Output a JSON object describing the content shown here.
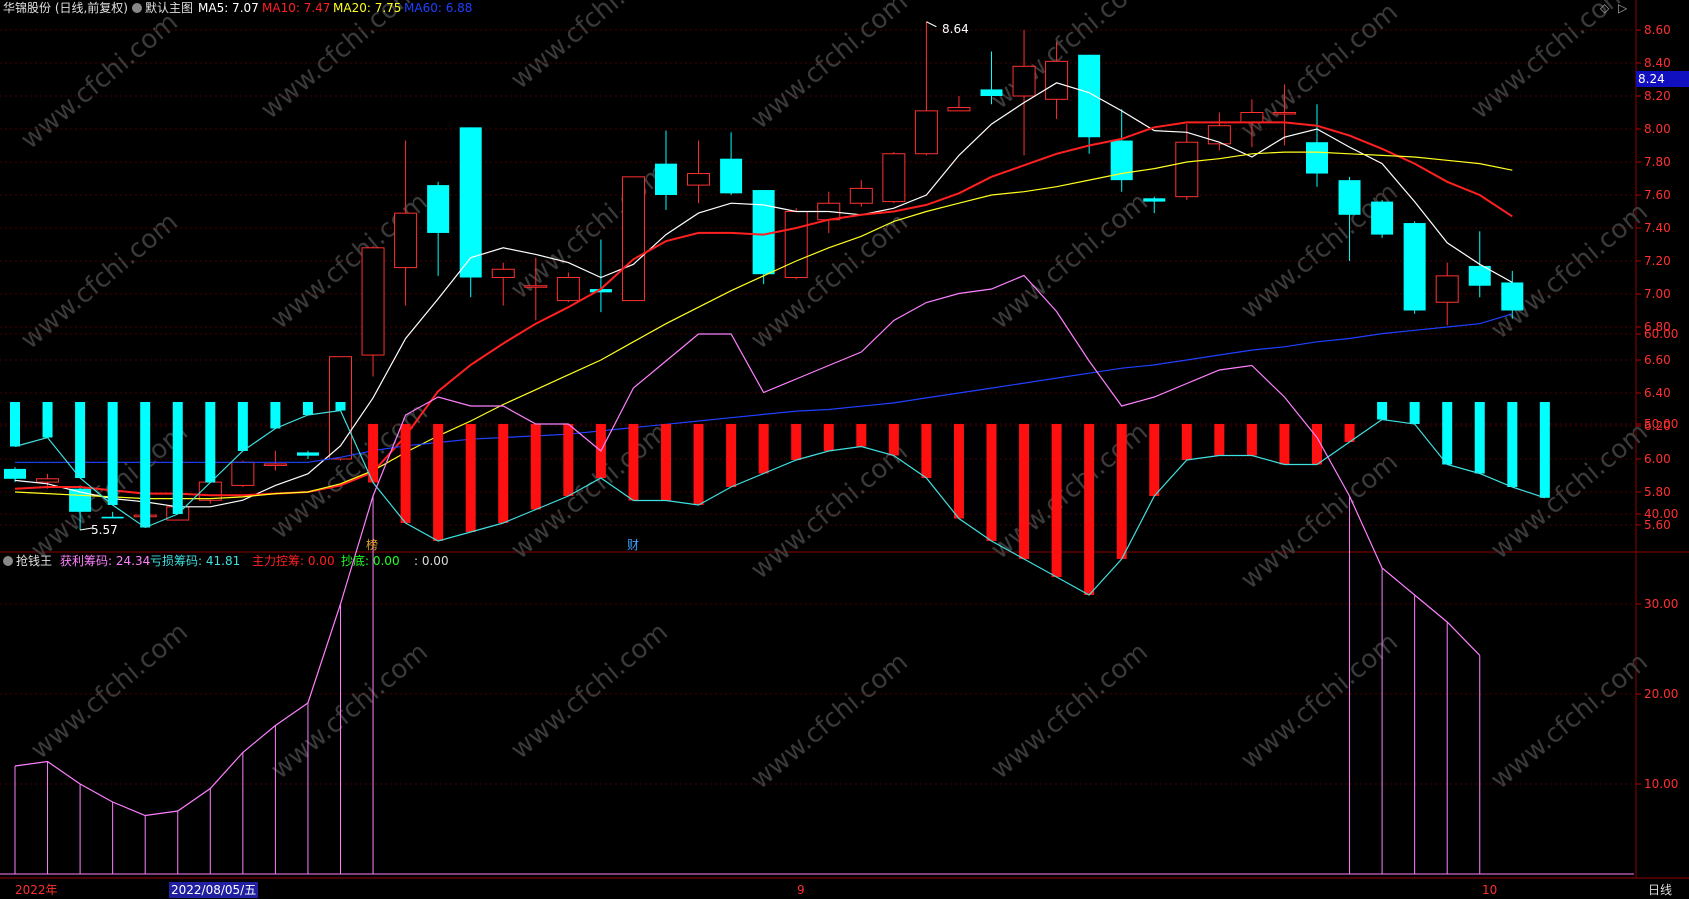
{
  "header": {
    "stock": "华锦股份 (日线,前复权)",
    "template": "默认主图",
    "ma": [
      {
        "label": "MA5: 7.07",
        "color": "#ffffff"
      },
      {
        "label": "MA10: 7.47",
        "color": "#ff2020"
      },
      {
        "label": "MA20: 7.75",
        "color": "#ffff20"
      },
      {
        "label": "MA60: 6.88",
        "color": "#2040ff"
      }
    ]
  },
  "indicator": {
    "name": "抢钱王",
    "items": [
      {
        "label": "获利筹码: 24.34",
        "color": "#ff80ff"
      },
      {
        "label": "亏损筹码: 41.81",
        "color": "#40e0e0"
      },
      {
        "label": "主力控筹: 0.00",
        "color": "#ff2020"
      },
      {
        "label": "抄底: 0.00",
        "color": "#20ff20"
      },
      {
        "label": ": 0.00",
        "color": "#dddddd"
      }
    ]
  },
  "markers": {
    "high": "8.64",
    "low": "5.57",
    "current": "8.24",
    "bang": "榜",
    "cai": "财"
  },
  "xaxis": {
    "year": "2022年",
    "date": "2022/08/05/五",
    "m9": "9",
    "m10": "10",
    "period": "日线"
  },
  "watermark": "www.cfchi.com",
  "chart_data": [
    {
      "type": "candlestick",
      "ylim": [
        5.45,
        8.72
      ],
      "yticks": [
        "8.60",
        "8.40",
        "8.20",
        "8.00",
        "7.80",
        "7.60",
        "7.40",
        "7.20",
        "7.00",
        "6.80",
        "6.60",
        "6.40",
        "6.20",
        "6.00",
        "5.80",
        "5.60"
      ],
      "candles": [
        {
          "o": 5.94,
          "c": 5.88,
          "h": 5.95,
          "l": 5.86
        },
        {
          "o": 5.86,
          "c": 5.88,
          "h": 5.91,
          "l": 5.82
        },
        {
          "o": 5.82,
          "c": 5.68,
          "h": 5.84,
          "l": 5.57
        },
        {
          "o": 5.65,
          "c": 5.64,
          "h": 5.68,
          "l": 5.64
        },
        {
          "o": 5.65,
          "c": 5.66,
          "h": 5.7,
          "l": 5.62
        },
        {
          "o": 5.63,
          "c": 5.71,
          "h": 5.74,
          "l": 5.63
        },
        {
          "o": 5.75,
          "c": 5.86,
          "h": 5.87,
          "l": 5.73
        },
        {
          "o": 5.84,
          "c": 5.98,
          "h": 5.99,
          "l": 5.83
        },
        {
          "o": 5.97,
          "c": 5.97,
          "h": 6.05,
          "l": 5.93
        },
        {
          "o": 6.04,
          "c": 6.02,
          "h": 6.05,
          "l": 6.0
        },
        {
          "o": 6.0,
          "c": 6.62,
          "h": 6.62,
          "l": 5.99
        },
        {
          "o": 6.63,
          "c": 7.28,
          "h": 7.29,
          "l": 6.5
        },
        {
          "o": 7.16,
          "c": 7.49,
          "h": 7.93,
          "l": 6.93
        },
        {
          "o": 7.66,
          "c": 7.37,
          "h": 7.68,
          "l": 7.11
        },
        {
          "o": 8.01,
          "c": 7.1,
          "h": 8.01,
          "l": 6.98
        },
        {
          "o": 7.1,
          "c": 7.15,
          "h": 7.19,
          "l": 6.93
        },
        {
          "o": 7.05,
          "c": 7.05,
          "h": 7.22,
          "l": 6.84
        },
        {
          "o": 6.96,
          "c": 7.1,
          "h": 7.13,
          "l": 6.95
        },
        {
          "o": 7.03,
          "c": 7.01,
          "h": 7.33,
          "l": 6.89
        },
        {
          "o": 6.96,
          "c": 7.71,
          "h": 7.71,
          "l": 6.96
        },
        {
          "o": 7.79,
          "c": 7.6,
          "h": 7.99,
          "l": 7.51
        },
        {
          "o": 7.66,
          "c": 7.73,
          "h": 7.93,
          "l": 7.55
        },
        {
          "o": 7.82,
          "c": 7.61,
          "h": 7.98,
          "l": 7.6
        },
        {
          "o": 7.63,
          "c": 7.12,
          "h": 7.63,
          "l": 7.06
        },
        {
          "o": 7.1,
          "c": 7.5,
          "h": 7.52,
          "l": 7.09
        },
        {
          "o": 7.45,
          "c": 7.55,
          "h": 7.62,
          "l": 7.37
        },
        {
          "o": 7.55,
          "c": 7.64,
          "h": 7.69,
          "l": 7.53
        },
        {
          "o": 7.56,
          "c": 7.85,
          "h": 7.86,
          "l": 7.55
        },
        {
          "o": 7.85,
          "c": 8.11,
          "h": 8.65,
          "l": 7.84
        },
        {
          "o": 8.11,
          "c": 8.13,
          "h": 8.2,
          "l": 8.11
        },
        {
          "o": 8.24,
          "c": 8.2,
          "h": 8.47,
          "l": 8.15
        },
        {
          "o": 8.2,
          "c": 8.38,
          "h": 8.6,
          "l": 7.84
        },
        {
          "o": 8.18,
          "c": 8.41,
          "h": 8.53,
          "l": 8.06
        },
        {
          "o": 8.45,
          "c": 7.95,
          "h": 8.45,
          "l": 7.85
        },
        {
          "o": 7.93,
          "c": 7.69,
          "h": 8.12,
          "l": 7.62
        },
        {
          "o": 7.58,
          "c": 7.56,
          "h": 7.59,
          "l": 7.49
        },
        {
          "o": 7.59,
          "c": 7.92,
          "h": 8.03,
          "l": 7.57
        },
        {
          "o": 7.91,
          "c": 8.02,
          "h": 8.1,
          "l": 7.87
        },
        {
          "o": 8.04,
          "c": 8.1,
          "h": 8.18,
          "l": 7.89
        },
        {
          "o": 8.1,
          "c": 8.1,
          "h": 8.27,
          "l": 7.9
        },
        {
          "o": 7.92,
          "c": 7.73,
          "h": 8.15,
          "l": 7.65
        },
        {
          "o": 7.69,
          "c": 7.48,
          "h": 7.71,
          "l": 7.2
        },
        {
          "o": 7.56,
          "c": 7.36,
          "h": 7.57,
          "l": 7.34
        },
        {
          "o": 7.43,
          "c": 6.9,
          "h": 7.44,
          "l": 6.88
        },
        {
          "o": 6.95,
          "c": 7.11,
          "h": 7.19,
          "l": 6.81
        },
        {
          "o": 7.17,
          "c": 7.05,
          "h": 7.38,
          "l": 6.98
        },
        {
          "o": 7.07,
          "c": 6.9,
          "h": 7.14,
          "l": 6.85
        }
      ],
      "series": [
        {
          "name": "MA5",
          "color": "#ffffff",
          "values": [
            5.87,
            5.85,
            5.8,
            5.76,
            5.74,
            5.71,
            5.71,
            5.75,
            5.84,
            5.91,
            6.08,
            6.37,
            6.73,
            6.97,
            7.22,
            7.28,
            7.24,
            7.19,
            7.1,
            7.18,
            7.36,
            7.49,
            7.55,
            7.54,
            7.5,
            7.5,
            7.48,
            7.52,
            7.6,
            7.84,
            8.03,
            8.16,
            8.28,
            8.22,
            8.11,
            7.99,
            7.98,
            7.92,
            7.83,
            7.95,
            8.0,
            7.89,
            7.79,
            7.56,
            7.31,
            7.18,
            7.07
          ]
        },
        {
          "name": "MA10",
          "color": "#ff2020",
          "values": [
            5.82,
            5.83,
            5.83,
            5.81,
            5.79,
            5.79,
            5.78,
            5.78,
            5.79,
            5.8,
            5.84,
            5.92,
            6.14,
            6.41,
            6.57,
            6.7,
            6.82,
            6.92,
            7.03,
            7.21,
            7.32,
            7.37,
            7.37,
            7.36,
            7.4,
            7.45,
            7.48,
            7.5,
            7.54,
            7.61,
            7.71,
            7.78,
            7.85,
            7.9,
            7.94,
            8.01,
            8.04,
            8.04,
            8.04,
            8.04,
            8.02,
            7.96,
            7.88,
            7.79,
            7.68,
            7.6,
            7.47
          ]
        },
        {
          "name": "MA20",
          "color": "#ffff20",
          "values": [
            5.8,
            5.79,
            5.78,
            5.77,
            5.76,
            5.76,
            5.76,
            5.77,
            5.79,
            5.8,
            5.85,
            5.93,
            6.04,
            6.14,
            6.23,
            6.33,
            6.42,
            6.51,
            6.6,
            6.71,
            6.82,
            6.92,
            7.02,
            7.11,
            7.2,
            7.28,
            7.35,
            7.44,
            7.5,
            7.55,
            7.6,
            7.62,
            7.65,
            7.69,
            7.73,
            7.76,
            7.8,
            7.82,
            7.85,
            7.86,
            7.86,
            7.85,
            7.84,
            7.83,
            7.81,
            7.79,
            7.75
          ]
        },
        {
          "name": "MA60",
          "color": "#2040ff",
          "values": [
            5.98,
            5.98,
            5.98,
            5.98,
            5.98,
            5.98,
            5.98,
            5.98,
            5.98,
            5.98,
            6.01,
            6.05,
            6.08,
            6.1,
            6.12,
            6.13,
            6.14,
            6.15,
            6.17,
            6.19,
            6.21,
            6.23,
            6.25,
            6.27,
            6.29,
            6.3,
            6.32,
            6.34,
            6.37,
            6.4,
            6.43,
            6.46,
            6.49,
            6.52,
            6.55,
            6.57,
            6.6,
            6.63,
            6.66,
            6.68,
            6.71,
            6.73,
            6.76,
            6.78,
            6.8,
            6.82,
            6.88
          ]
        }
      ]
    },
    {
      "type": "bar",
      "ylim": [
        0,
        70
      ],
      "yticks": [
        "60.00",
        "50.00",
        "40.00",
        "30.00",
        "20.00",
        "10.00"
      ],
      "baseline": 50,
      "series": [
        {
          "name": "亏损筹码",
          "color": "#40e0e0",
          "values": [
            47.5,
            48.5,
            44,
            41,
            38.5,
            40,
            43.5,
            47,
            49.5,
            51,
            51.5,
            43.5,
            39,
            37,
            38,
            39,
            40.5,
            42,
            44,
            41.5,
            41.5,
            41,
            43,
            44.5,
            46,
            47,
            47.5,
            46.5,
            44,
            39.5,
            37,
            35,
            33,
            31,
            35,
            42,
            46,
            46.5,
            46.5,
            45.5,
            45.5,
            48,
            50.5,
            50,
            45.5,
            44.5,
            43,
            41.8
          ]
        },
        {
          "name": "获利筹码",
          "color": "#ff80ff",
          "values": [
            12,
            12.5,
            10,
            8,
            6.5,
            7,
            9.5,
            13.5,
            16.5,
            19,
            30,
            42,
            51,
            53,
            52,
            52,
            50,
            50,
            47,
            54,
            57,
            60,
            60,
            53.5,
            55,
            56.5,
            58,
            61.5,
            63.5,
            64.5,
            65,
            66.5,
            62.5,
            57,
            52,
            53,
            54.5,
            56,
            56.5,
            53,
            48.5,
            42,
            34,
            31,
            28,
            24.3
          ]
        }
      ]
    }
  ]
}
